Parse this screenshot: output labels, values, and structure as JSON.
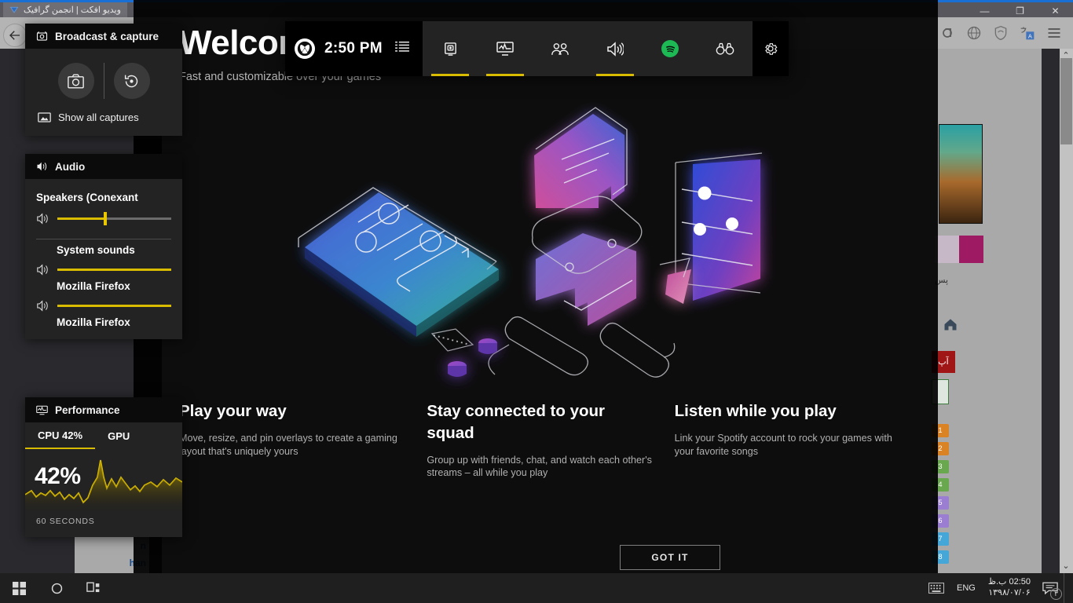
{
  "background_window": {
    "tab_title": "ویدیو افکت | انجمن گرافیک",
    "minimize_label": "—",
    "maximize_label": "❐",
    "close_label": "✕",
    "persian_snippet": "پس",
    "red_label": "آپ",
    "doc_line1": "n",
    "doc_line2": "han",
    "chips": [
      "1",
      "2",
      "3",
      "4",
      "5",
      "6",
      "7",
      "8"
    ]
  },
  "taskbar": {
    "start_label": "start-button",
    "search_label": "search-button",
    "taskview_label": "task-view-button",
    "keyboard_label": "touch-keyboard-button",
    "language": "ENG",
    "clock_time": "02:50 ب.ظ",
    "clock_date": "۱۳۹۸/۰۷/۰۶",
    "notification_count": "۳"
  },
  "gamebar": {
    "time": "2:50 PM",
    "xbox_label": "Xbox",
    "menu_label": "Widget menu",
    "buttons": [
      {
        "name": "capture",
        "icon": "capture-icon",
        "underline": true
      },
      {
        "name": "performance",
        "icon": "performance-icon",
        "underline": true
      },
      {
        "name": "xbox-social",
        "icon": "social-icon",
        "underline": false
      },
      {
        "name": "audio",
        "icon": "audio-icon",
        "underline": true
      },
      {
        "name": "spotify",
        "icon": "spotify-icon",
        "underline": false
      },
      {
        "name": "looking-for-group",
        "icon": "binoculars-icon",
        "underline": false
      }
    ],
    "settings_label": "Settings",
    "accent_color": "#d9bb00",
    "spotify_color": "#1db954"
  },
  "capture_widget": {
    "title": "Broadcast & capture",
    "screenshot_label": "Take screenshot",
    "record_last_label": "Record last 30 sec",
    "show_all_label": "Show all captures"
  },
  "audio_widget": {
    "title": "Audio",
    "device": "Speakers (Conexant",
    "device_volume": 42,
    "apps": [
      {
        "name": "System sounds",
        "volume": 100
      },
      {
        "name": "Mozilla Firefox",
        "volume": 100
      },
      {
        "name": "Mozilla Firefox",
        "volume": 100
      }
    ]
  },
  "performance_widget": {
    "title": "Performance",
    "tabs": [
      {
        "label": "CPU",
        "value": "42%",
        "active": true
      },
      {
        "label": "GPU",
        "value": "",
        "active": false
      }
    ],
    "cpu_tab_label": "CPU  42%",
    "gpu_tab_label": "GPU",
    "big_value": "42%",
    "footer": "60 SECONDS",
    "accent_color": "#d9bb00"
  },
  "welcome": {
    "title": "Welcome",
    "subtitle": "Fast and customizable over your games",
    "columns": [
      {
        "heading": "Play your way",
        "body": "Move, resize, and pin overlays to create a gaming layout that's uniquely yours"
      },
      {
        "heading": "Stay connected to your squad",
        "body": "Group up with friends, chat, and watch each other's streams – all while you play"
      },
      {
        "heading": "Listen while you play",
        "body": "Link your Spotify account to rock your games with your favorite songs"
      }
    ],
    "cta_label": "GOT IT",
    "back_label": "Back"
  }
}
